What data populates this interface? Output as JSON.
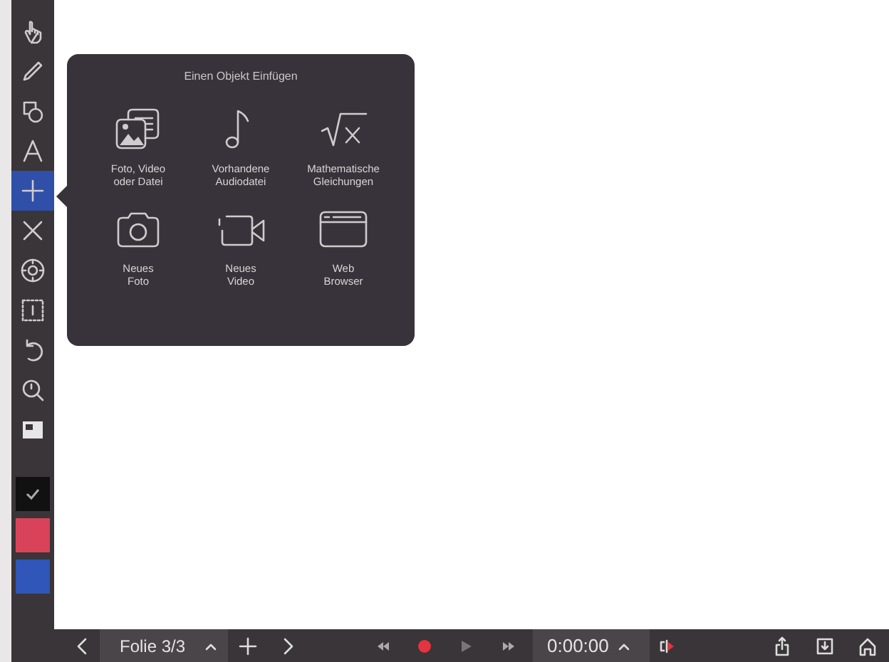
{
  "toolbar": {
    "tools": [
      {
        "selected": false
      },
      {
        "selected": false
      },
      {
        "selected": false
      },
      {
        "selected": false
      },
      {
        "selected": true
      },
      {
        "selected": false
      },
      {
        "selected": false
      },
      {
        "selected": false
      },
      {
        "selected": false
      },
      {
        "selected": false
      },
      {
        "selected": false
      }
    ],
    "swatches": [
      {
        "color": "#111111",
        "checked": true
      },
      {
        "color": "#d9435a",
        "checked": false
      },
      {
        "color": "#2f56b8",
        "checked": false
      }
    ]
  },
  "popup": {
    "title": "Einen Objekt Einfügen",
    "items": [
      {
        "label": "Foto, Video\noder Datei"
      },
      {
        "label": "Vorhandene\nAudiodatei"
      },
      {
        "label": "Mathematische\nGleichungen"
      },
      {
        "label": "Neues\nFoto"
      },
      {
        "label": "Neues\nVideo"
      },
      {
        "label": "Web\nBrowser"
      }
    ]
  },
  "bottom_bar": {
    "slide": "Folie 3/3",
    "time": "0:00:00"
  }
}
